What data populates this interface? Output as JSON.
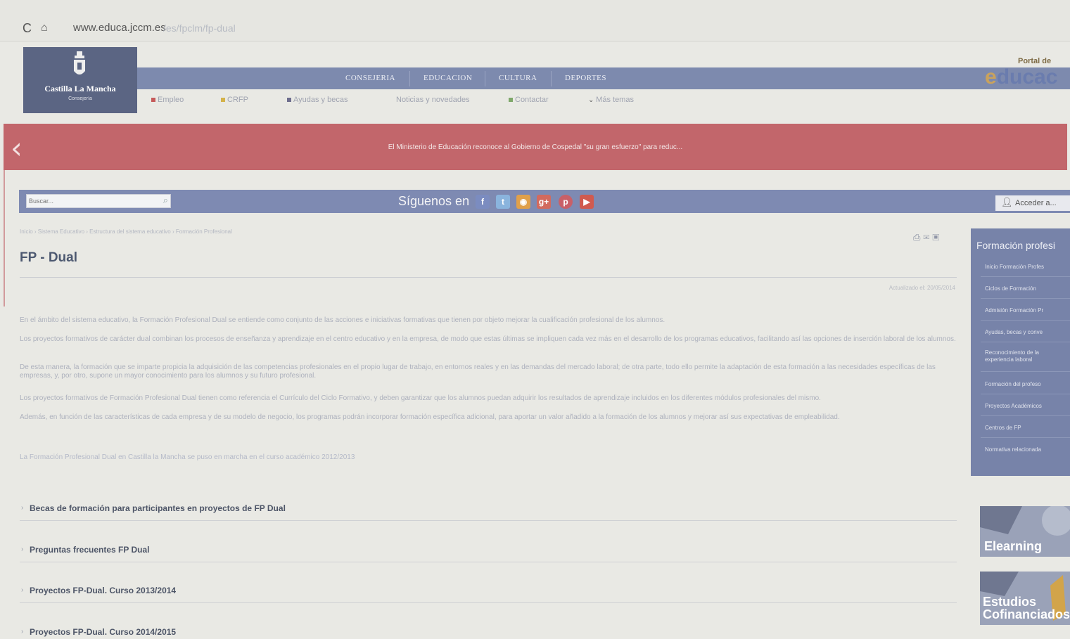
{
  "browser": {
    "url_host": "www.educa.jccm.es",
    "url_path": "/es/fpclm/fp-dual"
  },
  "header": {
    "logo_name": "Castilla La Mancha",
    "logo_sub": "Consejería",
    "nav": [
      "CONSEJERIA",
      "EDUCACION",
      "CULTURA",
      "DEPORTES"
    ],
    "portal_label": "Portal de",
    "brand_e": "e",
    "brand_rest": "ducac",
    "subnav": [
      {
        "label": "Empleo",
        "color": "#c65a5a"
      },
      {
        "label": "CRFP",
        "color": "#d4b24a"
      },
      {
        "label": "Ayudas y becas",
        "color": "#6e6e8e"
      },
      {
        "label": "Noticias y novedades",
        "color": ""
      },
      {
        "label": "Contactar",
        "color": "#7fa86a"
      },
      {
        "label": "Más temas",
        "color": ""
      }
    ]
  },
  "banner": {
    "text": "El Ministerio de Educación reconoce al Gobierno de Cospedal \"su gran esfuerzo\" para reduc..."
  },
  "searchbar": {
    "placeholder": "Buscar...",
    "follow": "Síguenos en",
    "social": [
      {
        "icon": "facebook-icon",
        "glyph": "f",
        "color": "#7b8cc0"
      },
      {
        "icon": "twitter-icon",
        "glyph": "t",
        "color": "#8ab4dd"
      },
      {
        "icon": "rss-icon",
        "glyph": "◉",
        "color": "#e0a04a"
      },
      {
        "icon": "googleplus-icon",
        "glyph": "g+",
        "color": "#d26a5e"
      },
      {
        "icon": "pinterest-icon",
        "glyph": "p",
        "color": "#c96068"
      },
      {
        "icon": "youtube-icon",
        "glyph": "▶",
        "color": "#d05a4f"
      }
    ],
    "access": "Acceder a..."
  },
  "main": {
    "breadcrumb": "Inicio › Sistema Educativo › Estructura del sistema educativo › Formación Profesional",
    "title": "FP - Dual",
    "updated": "Actualizado el: 20/05/2014",
    "paragraphs": [
      "En el ámbito del sistema educativo, la Formación Profesional Dual se entiende como conjunto de las acciones e iniciativas formativas que tienen por objeto mejorar la cualificación profesional de los alumnos.",
      "Los proyectos formativos de carácter dual combinan los procesos de enseñanza y aprendizaje en el centro educativo y en la empresa, de modo que estas últimas se impliquen cada vez más en el desarrollo de los programas educativos, facilitando así las opciones de inserción laboral de los alumnos.",
      "De esta manera, la formación que se imparte propicia la adquisición de las competencias profesionales en el propio lugar de trabajo, en entornos reales y en las demandas del mercado laboral; de otra parte, todo ello permite la adaptación de esta formación a las necesidades específicas de las empresas, y, por otro, supone un mayor conocimiento para los alumnos y su futuro profesional.",
      "Los proyectos formativos de Formación Profesional Dual tienen como referencia el Currículo del Ciclo Formativo, y deben garantizar que los alumnos puedan adquirir los resultados de aprendizaje incluidos en los diferentes módulos profesionales del mismo.",
      "Además, en función de las características de cada empresa y de su modelo de negocio, los programas podrán incorporar formación específica adicional, para aportar un valor añadido a la formación de los alumnos y mejorar así sus expectativas de empleabilidad.",
      "La Formación Profesional Dual en Castilla la Mancha se puso en marcha en el curso académico 2012/2013"
    ],
    "accordion": [
      "Becas de formación para participantes en proyectos de FP Dual",
      "Preguntas frecuentes FP Dual",
      "Proyectos FP-Dual. Curso 2013/2014",
      "Proyectos FP-Dual. Curso 2014/2015"
    ]
  },
  "sidebar": {
    "heading": "Formación profesi",
    "items": [
      "Inicio Formación Profes",
      "Ciclos de Formación",
      "Admisión Formación Pr",
      "Ayudas, becas y conve",
      "Reconocimiento de la experiencia laboral",
      "Formación del profeso",
      "Proyectos Académicos",
      "Centros de FP",
      "Normativa relacionada"
    ],
    "tiles": [
      "Elearning",
      "Estudios Cofinanciados"
    ]
  }
}
